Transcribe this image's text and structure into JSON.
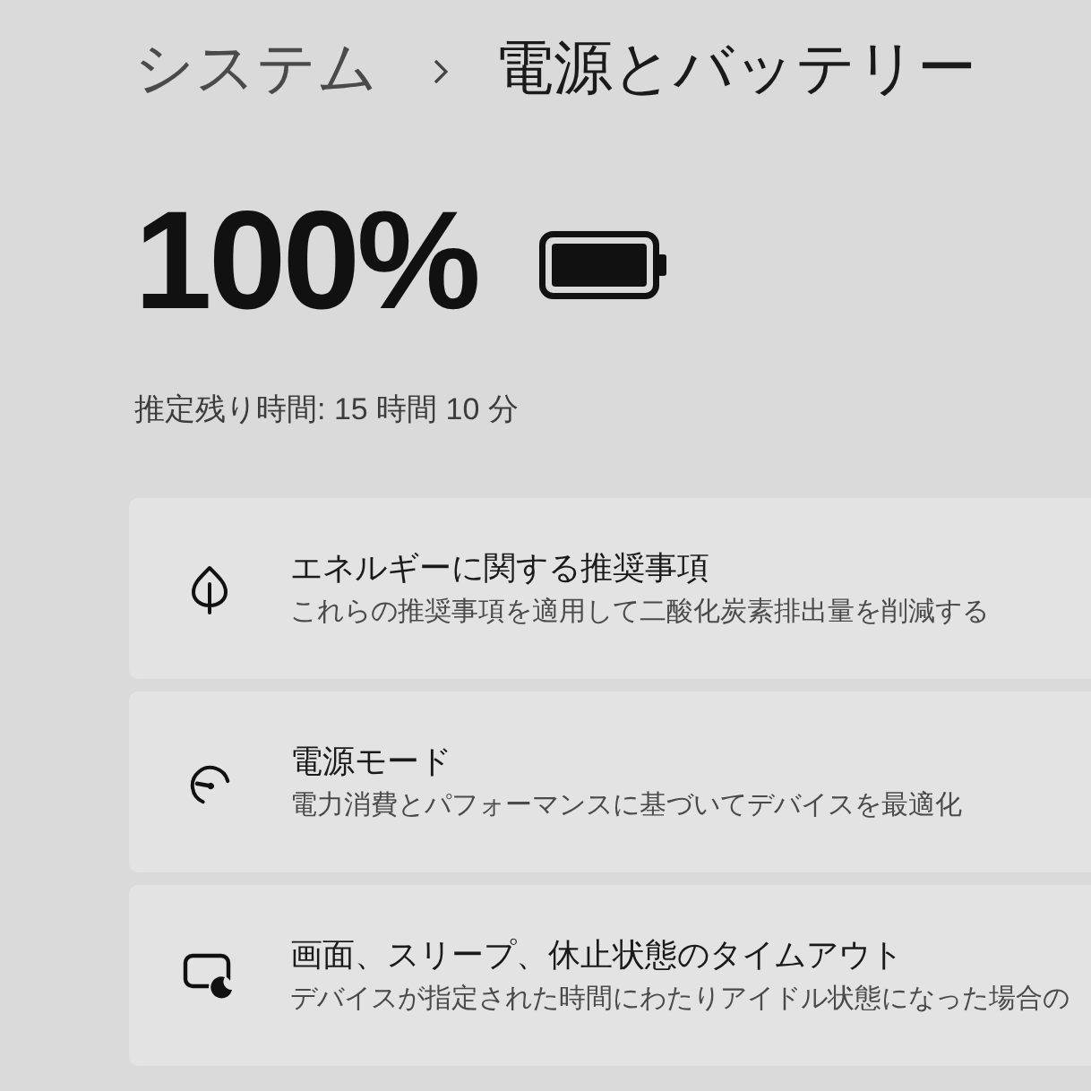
{
  "breadcrumb": {
    "parent": "システム",
    "current": "電源とバッテリー"
  },
  "battery": {
    "percentage": "100%",
    "estimated_time": "推定残り時間: 15 時間 10 分"
  },
  "cards": [
    {
      "kind": "leaf",
      "title": "エネルギーに関する推奨事項",
      "subtitle": "これらの推奨事項を適用して二酸化炭素排出量を削減する"
    },
    {
      "kind": "gauge",
      "title": "電源モード",
      "subtitle": "電力消費とパフォーマンスに基づいてデバイスを最適化"
    },
    {
      "kind": "sleep",
      "title": "画面、スリープ、休止状態のタイムアウト",
      "subtitle": "デバイスが指定された時間にわたりアイドル状態になった場合の"
    }
  ]
}
